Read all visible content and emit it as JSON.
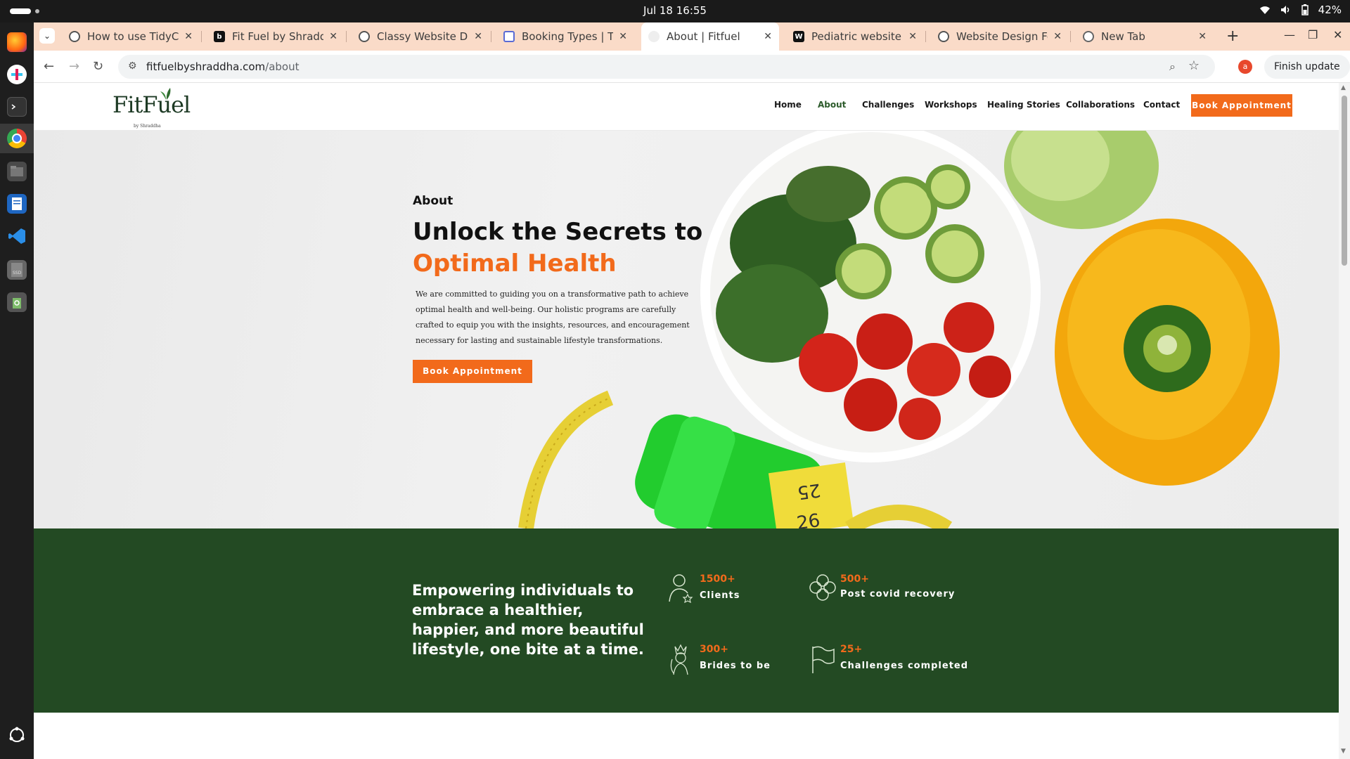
{
  "system": {
    "clock": "Jul 18  16:55",
    "battery": "42%"
  },
  "browser": {
    "tabs": [
      {
        "title": "How to use TidyCal",
        "favicon": "generic-globe-icon"
      },
      {
        "title": "Fit Fuel by Shraddha",
        "favicon": "b-logo-icon"
      },
      {
        "title": "Classy Website Desi",
        "favicon": "generic-globe-icon"
      },
      {
        "title": "Booking Types | Tidy",
        "favicon": "calendar-icon"
      },
      {
        "title": "About | Fitfuel",
        "favicon": "fitfuel-icon",
        "active": true
      },
      {
        "title": "Pediatric website de",
        "favicon": "wix-icon"
      },
      {
        "title": "Website Design Fee",
        "favicon": "generic-globe-icon"
      },
      {
        "title": "New Tab",
        "favicon": "chrome-icon"
      }
    ],
    "url_host": "fitfuelbyshraddha.com",
    "url_path": "/about",
    "profile_initial": "a",
    "finish_update": "Finish update"
  },
  "site": {
    "logo": {
      "word": "FitFuel",
      "sub": "by Shraddha"
    },
    "nav": [
      "Home",
      "About",
      "Challenges",
      "Workshops",
      "Healing Stories",
      "Collaborations",
      "Contact"
    ],
    "cta": "Book Appointment",
    "hero": {
      "label": "About",
      "title_line1": "Unlock the Secrets to",
      "title_line2": "Optimal Health",
      "paragraph": "We are committed to guiding you on a transformative path to achieve optimal health and well-being. Our holistic programs are carefully crafted to equip you with the insights, resources, and encouragement necessary for lasting and sustainable lifestyle transformations.",
      "cta": "Book Appointment"
    },
    "band": {
      "tagline": "Empowering individuals to embrace a healthier, happier, and more beautiful lifestyle, one bite at a time.",
      "stats": [
        {
          "number": "1500+",
          "label": "Clients",
          "icon": "person-star-icon"
        },
        {
          "number": "500+",
          "label": "Post covid recovery",
          "icon": "clover-icon"
        },
        {
          "number": "300+",
          "label": "Brides to be",
          "icon": "bride-icon"
        },
        {
          "number": "25+",
          "label": "Challenges completed",
          "icon": "flag-icon"
        }
      ]
    }
  },
  "colors": {
    "accent": "#f26a1b",
    "band": "#234a23",
    "tabstrip": "#fadbc8"
  }
}
